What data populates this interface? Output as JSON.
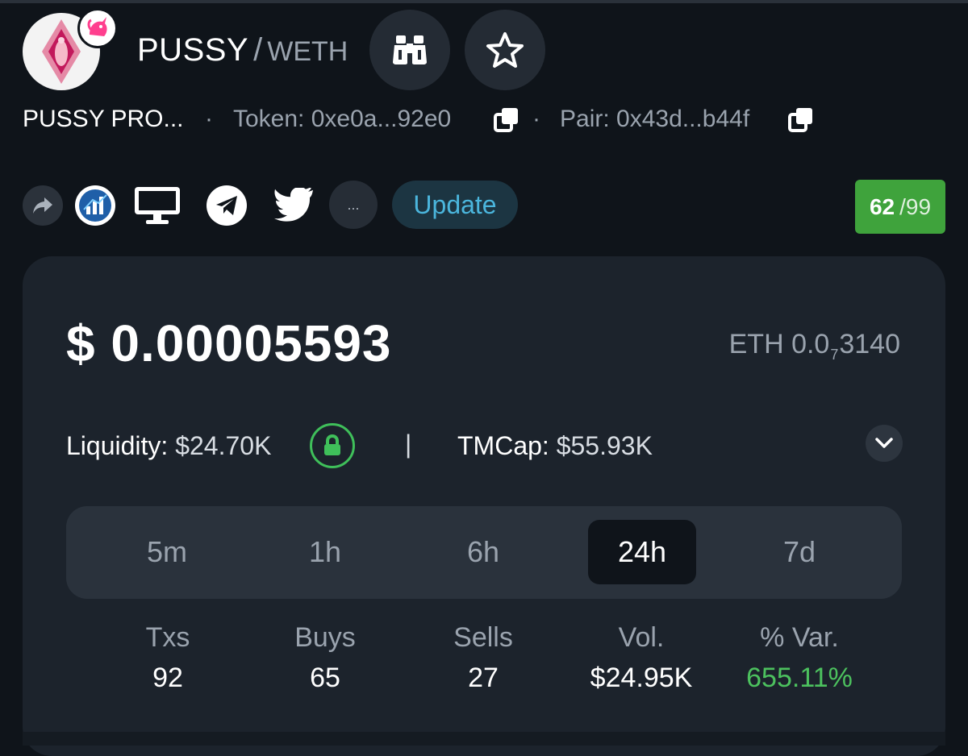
{
  "header": {
    "base_symbol": "PUSSY",
    "separator": "/",
    "quote_symbol": "WETH",
    "token_name": "PUSSY PRO...",
    "token_label": "Token: 0xe0a...92e0",
    "pair_label": "Pair: 0x43d...b44f",
    "dot": "·"
  },
  "icons": {
    "logo": "token-logo",
    "dex": "uniswap-unicorn-icon",
    "watch": "binoculars-icon",
    "favorite": "star-icon",
    "copy": "copy-icon",
    "share": "share-icon",
    "chart": "chart-icon",
    "website": "monitor-icon",
    "telegram": "telegram-icon",
    "twitter": "twitter-icon",
    "lock": "lock-icon",
    "expand": "chevron-down-icon"
  },
  "social": {
    "more_label": "...",
    "update_label": "Update"
  },
  "score": {
    "value": "62",
    "max": "/99",
    "color": "#3fa33c"
  },
  "price": {
    "usd": "$ 0.00005593",
    "eth_prefix": "ETH 0.0",
    "eth_zeros": "7",
    "eth_digits": "3140"
  },
  "liquidity": {
    "label": "Liquidity:",
    "value": "$24.70K",
    "divider": "|",
    "mcap_label": "TMCap:",
    "mcap_value": "$55.93K"
  },
  "tabs": [
    {
      "label": "5m",
      "active": false
    },
    {
      "label": "1h",
      "active": false
    },
    {
      "label": "6h",
      "active": false
    },
    {
      "label": "24h",
      "active": true
    },
    {
      "label": "7d",
      "active": false
    }
  ],
  "stats": [
    {
      "label": "Txs",
      "value": "92"
    },
    {
      "label": "Buys",
      "value": "65"
    },
    {
      "label": "Sells",
      "value": "27"
    },
    {
      "label": "Vol.",
      "value": "$24.95K"
    },
    {
      "label": "% Var.",
      "value": "655.11%"
    }
  ],
  "colors": {
    "background": "#0f141a",
    "card": "#1c232c",
    "accent_blue": "#4bb6dd",
    "positive": "#4cc15e",
    "lock_green": "#3fbf5a"
  }
}
